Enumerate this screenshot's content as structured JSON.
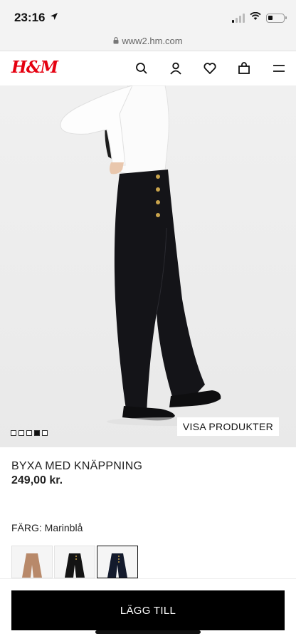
{
  "status": {
    "time": "23:16"
  },
  "browser": {
    "url": "www2.hm.com"
  },
  "header": {
    "logo": "H&M",
    "icons": [
      "search-icon",
      "account-icon",
      "favorites-icon",
      "bag-icon",
      "menu-icon"
    ]
  },
  "gallery": {
    "image_count": 5,
    "active_index": 3,
    "visa_produkter_label": "VISA PRODUKTER"
  },
  "product": {
    "title": "BYXA MED KNÄPPNING",
    "price": "249,00 kr.",
    "color_label": "FÄRG:",
    "color_value": "Marinblå",
    "swatch_colors": [
      "#b8896a",
      "#141414",
      "#131a2c"
    ],
    "selected_swatch": 2
  },
  "actions": {
    "add_to_bag": "LÄGG TILL"
  },
  "colors": {
    "brand": "#e50010",
    "button_bg": "#000000"
  }
}
